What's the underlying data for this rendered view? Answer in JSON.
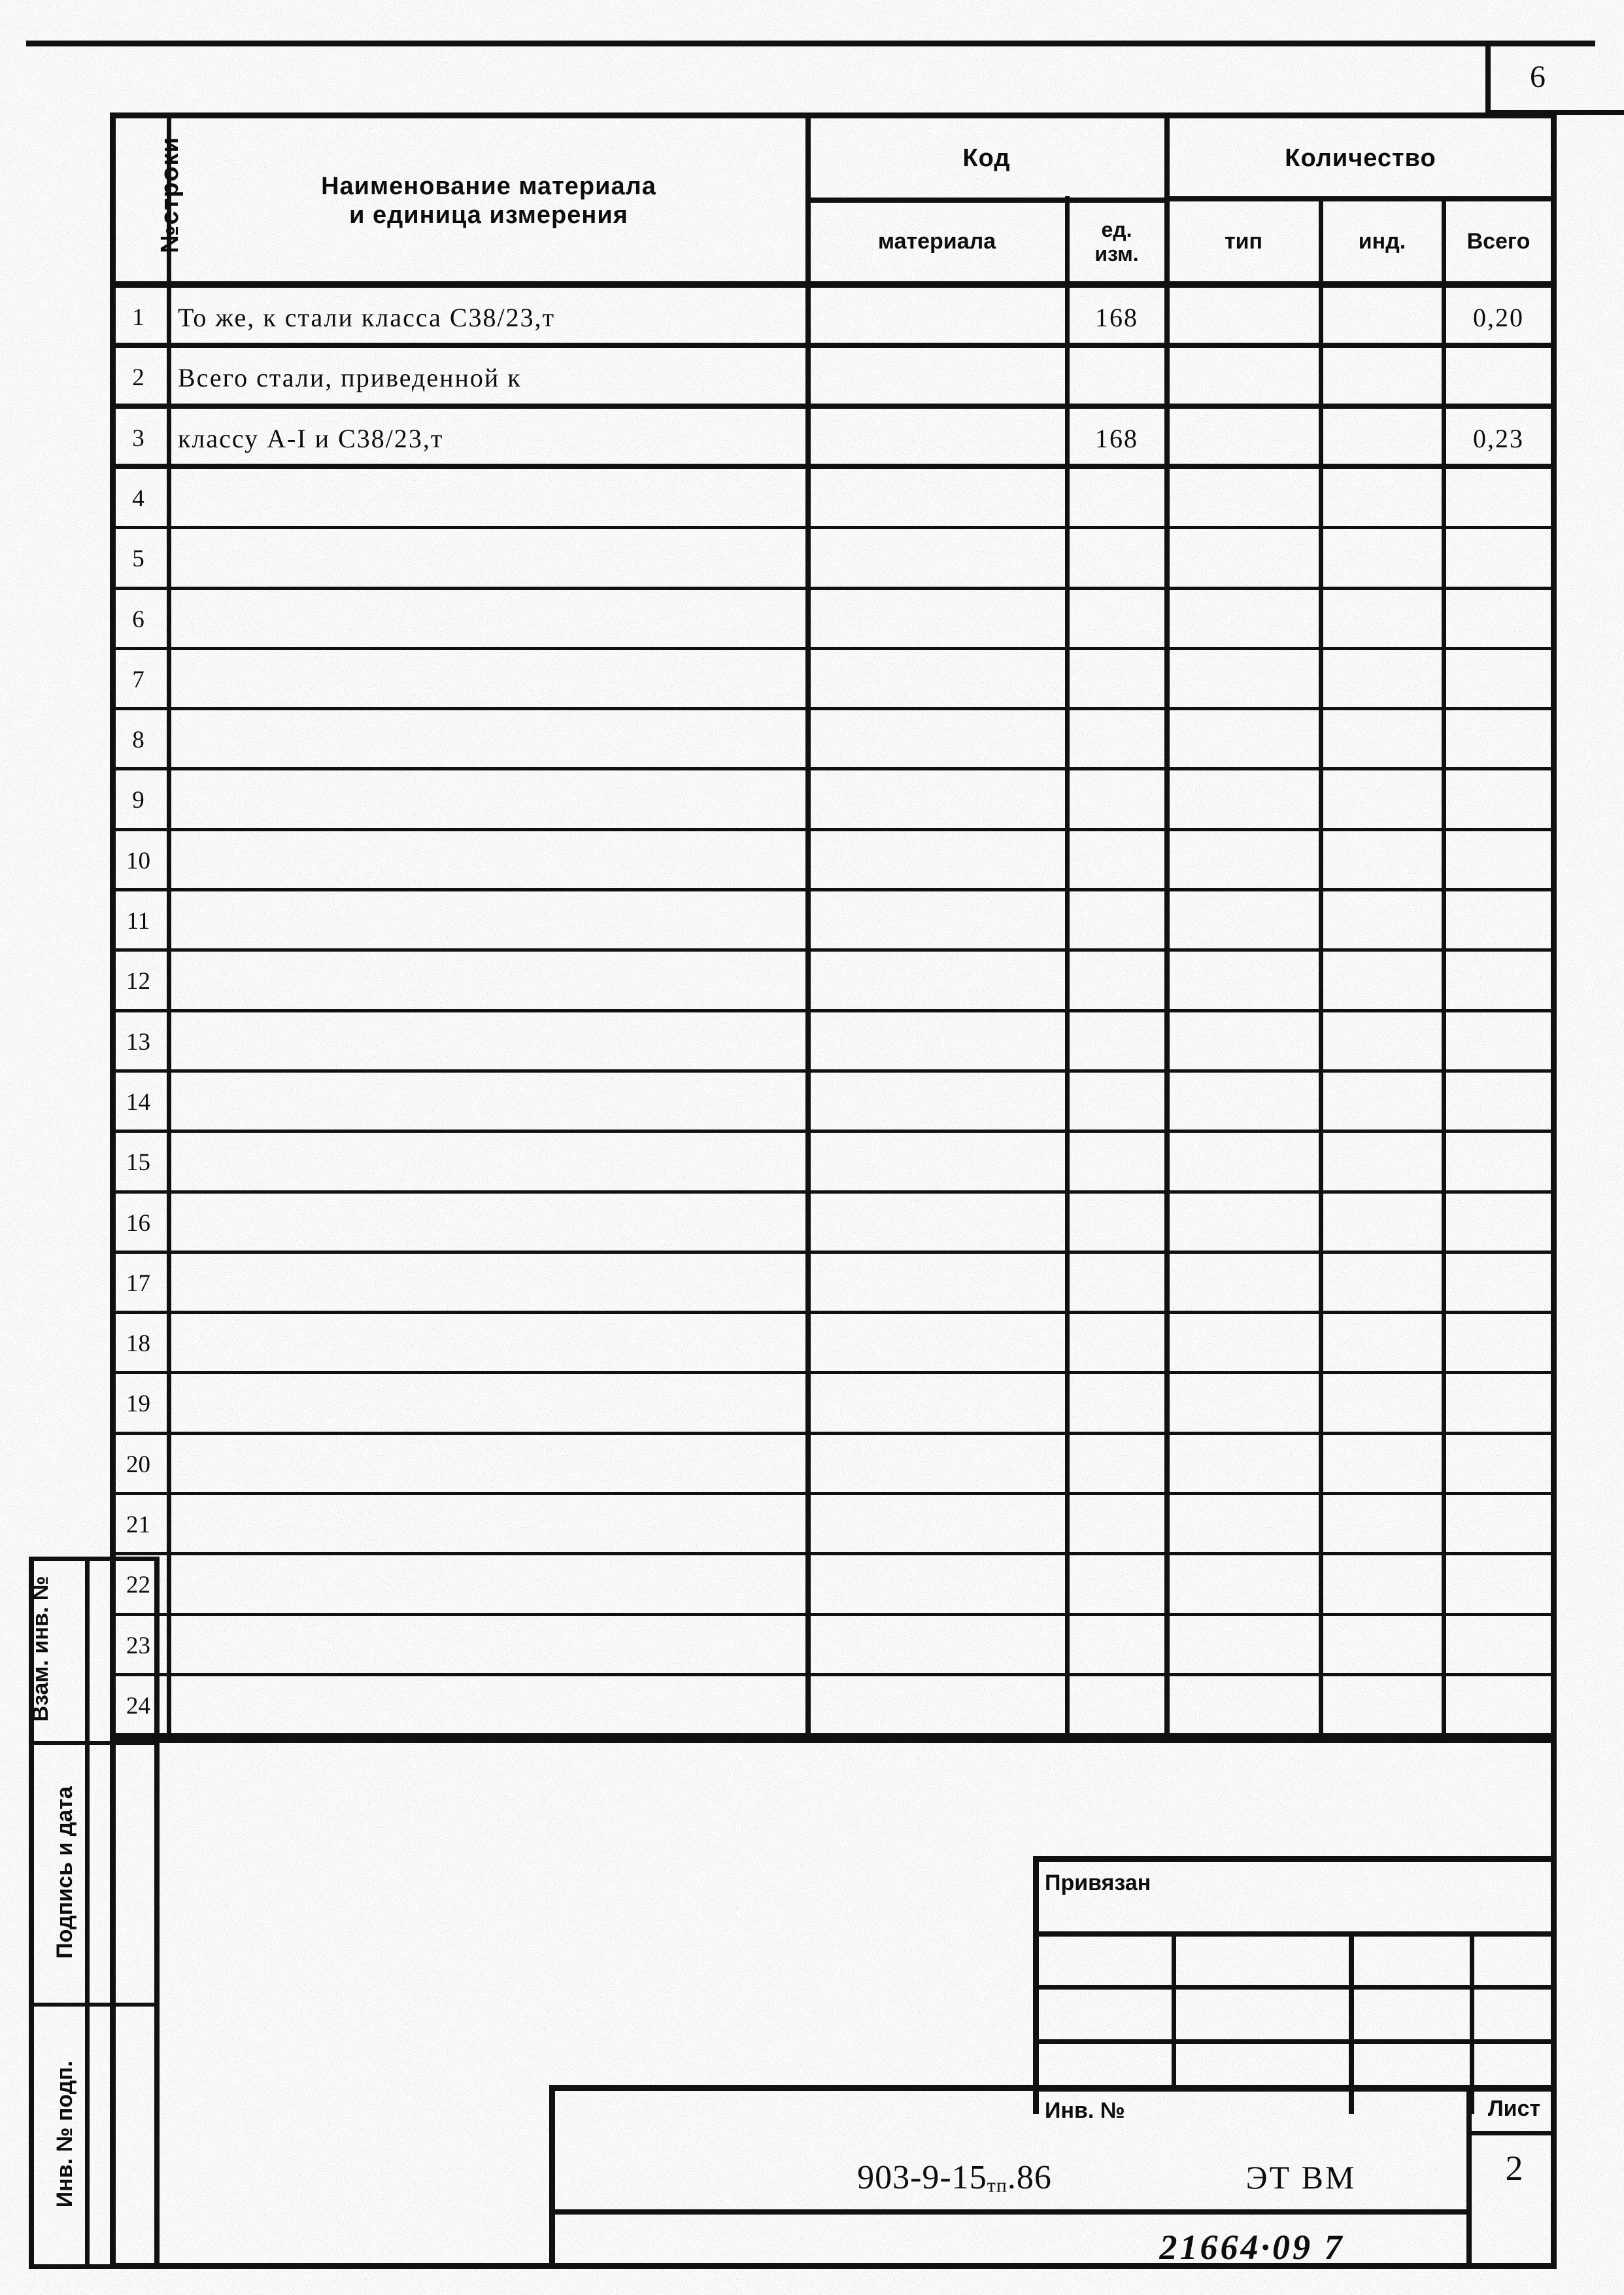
{
  "page": {
    "number": "6",
    "sheet_label": "Лист",
    "sheet_value": "2",
    "document_code_main": "903-9-15",
    "document_code_sub": "тп",
    "document_code_tail": ".86",
    "org_mark": "ЭТ ВМ",
    "handwritten_note": "21664·09 7"
  },
  "sidebar": {
    "labels": [
      "Взам. инв. №",
      "Подпись и дата",
      "Инв. № подп."
    ]
  },
  "table": {
    "headers": {
      "row_number": "№строки",
      "material_name": "Наименование материала\nи единица  измерения",
      "code_group": "Код",
      "quantity_group": "Количество",
      "code_material": "материала",
      "code_unit": "ед.\nизм.",
      "qty_type": "тип",
      "qty_ind": "инд.",
      "qty_total": "Всего"
    },
    "rows": [
      {
        "n": "1",
        "name": "То же, к стали класса С38/23,т",
        "code_material": "",
        "code_unit": "168",
        "type": "",
        "ind": "",
        "total": "0,20"
      },
      {
        "n": "2",
        "name": "Всего стали, приведенной к",
        "code_material": "",
        "code_unit": "",
        "type": "",
        "ind": "",
        "total": ""
      },
      {
        "n": "3",
        "name": "классу А-I и С38/23,т",
        "code_material": "",
        "code_unit": "168",
        "type": "",
        "ind": "",
        "total": "0,23"
      },
      {
        "n": "4",
        "name": "",
        "code_material": "",
        "code_unit": "",
        "type": "",
        "ind": "",
        "total": ""
      },
      {
        "n": "5",
        "name": "",
        "code_material": "",
        "code_unit": "",
        "type": "",
        "ind": "",
        "total": ""
      },
      {
        "n": "6",
        "name": "",
        "code_material": "",
        "code_unit": "",
        "type": "",
        "ind": "",
        "total": ""
      },
      {
        "n": "7",
        "name": "",
        "code_material": "",
        "code_unit": "",
        "type": "",
        "ind": "",
        "total": ""
      },
      {
        "n": "8",
        "name": "",
        "code_material": "",
        "code_unit": "",
        "type": "",
        "ind": "",
        "total": ""
      },
      {
        "n": "9",
        "name": "",
        "code_material": "",
        "code_unit": "",
        "type": "",
        "ind": "",
        "total": ""
      },
      {
        "n": "10",
        "name": "",
        "code_material": "",
        "code_unit": "",
        "type": "",
        "ind": "",
        "total": ""
      },
      {
        "n": "11",
        "name": "",
        "code_material": "",
        "code_unit": "",
        "type": "",
        "ind": "",
        "total": ""
      },
      {
        "n": "12",
        "name": "",
        "code_material": "",
        "code_unit": "",
        "type": "",
        "ind": "",
        "total": ""
      },
      {
        "n": "13",
        "name": "",
        "code_material": "",
        "code_unit": "",
        "type": "",
        "ind": "",
        "total": ""
      },
      {
        "n": "14",
        "name": "",
        "code_material": "",
        "code_unit": "",
        "type": "",
        "ind": "",
        "total": ""
      },
      {
        "n": "15",
        "name": "",
        "code_material": "",
        "code_unit": "",
        "type": "",
        "ind": "",
        "total": ""
      },
      {
        "n": "16",
        "name": "",
        "code_material": "",
        "code_unit": "",
        "type": "",
        "ind": "",
        "total": ""
      },
      {
        "n": "17",
        "name": "",
        "code_material": "",
        "code_unit": "",
        "type": "",
        "ind": "",
        "total": ""
      },
      {
        "n": "18",
        "name": "",
        "code_material": "",
        "code_unit": "",
        "type": "",
        "ind": "",
        "total": ""
      },
      {
        "n": "19",
        "name": "",
        "code_material": "",
        "code_unit": "",
        "type": "",
        "ind": "",
        "total": ""
      },
      {
        "n": "20",
        "name": "",
        "code_material": "",
        "code_unit": "",
        "type": "",
        "ind": "",
        "total": ""
      },
      {
        "n": "21",
        "name": "",
        "code_material": "",
        "code_unit": "",
        "type": "",
        "ind": "",
        "total": ""
      },
      {
        "n": "22",
        "name": "",
        "code_material": "",
        "code_unit": "",
        "type": "",
        "ind": "",
        "total": ""
      },
      {
        "n": "23",
        "name": "",
        "code_material": "",
        "code_unit": "",
        "type": "",
        "ind": "",
        "total": ""
      },
      {
        "n": "24",
        "name": "",
        "code_material": "",
        "code_unit": "",
        "type": "",
        "ind": "",
        "total": ""
      }
    ]
  },
  "title_block": {
    "privyazan_label": "Привязан",
    "inv_label": "Инв.  №",
    "privyazan_rows": [
      [
        "",
        "",
        "",
        ""
      ],
      [
        "",
        "",
        "",
        ""
      ],
      [
        "",
        "",
        "",
        ""
      ]
    ],
    "inv_cells": [
      "",
      "",
      ""
    ]
  }
}
